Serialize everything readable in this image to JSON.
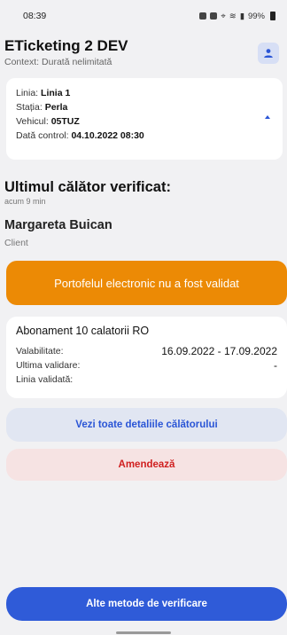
{
  "status_bar": {
    "time": "08:39",
    "battery": "99%"
  },
  "header": {
    "title": "ETicketing 2 DEV",
    "context": "Context: Durată nelimitată",
    "profile_icon": "user-icon"
  },
  "info_card": {
    "line_label": "Linia:",
    "line_value": "Linia 1",
    "station_label": "Stația:",
    "station_value": "Perla",
    "vehicle_label": "Vehicul:",
    "vehicle_value": "05TUZ",
    "control_label": "Dată control:",
    "control_value": "04.10.2022 08:30"
  },
  "last_traveler": {
    "heading": "Ultimul călător verificat:",
    "time_ago": "acum 9 min",
    "name": "Margareta Buican",
    "role": "Client"
  },
  "wallet_banner": "Portofelul electronic nu a fost validat",
  "subscription": {
    "title": "Abonament 10 calatorii RO",
    "validity_label": "Valabilitate:",
    "validity_value": "16.09.2022 - 17.09.2022",
    "last_validation_label": "Ultima validare:",
    "last_validation_value": "-",
    "validated_line_label": "Linia validată:",
    "validated_line_value": ""
  },
  "buttons": {
    "details": "Vezi toate detaliile călătorului",
    "fine": "Amendează",
    "other_methods": "Alte metode de verificare"
  },
  "colors": {
    "accent": "#2f5bd8",
    "warning": "#ec8a05",
    "danger": "#d01f1f"
  }
}
